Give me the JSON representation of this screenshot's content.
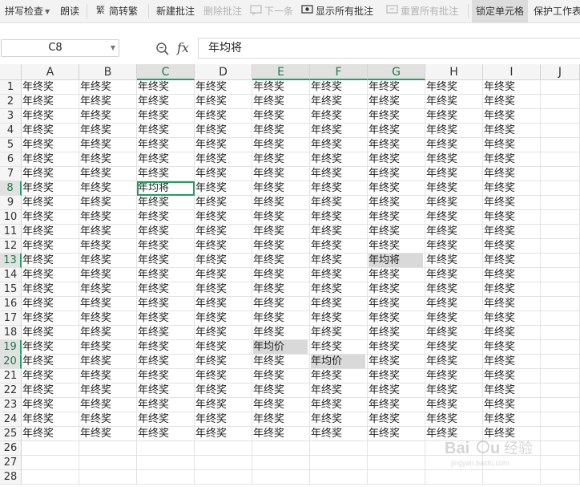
{
  "toolbar": {
    "spell_check": "拼写检查",
    "read_aloud": "朗读",
    "simp_trad": "简转繁",
    "new_comment": "新建批注",
    "delete_comment": "删除批注",
    "next": "下一条",
    "show_all_comments": "显示所有批注",
    "reset_all_comments": "重置所有批注",
    "lock_cell": "锁定单元格",
    "protect_sheet": "保护工作表"
  },
  "formula_bar": {
    "cell_ref": "C8",
    "fx_symbol": "fx",
    "content": "年均将"
  },
  "grid": {
    "columns": [
      "A",
      "B",
      "C",
      "D",
      "E",
      "F",
      "G",
      "H",
      "I",
      "J"
    ],
    "data_columns": [
      "A",
      "B",
      "C",
      "D",
      "E",
      "F",
      "G",
      "H",
      "I"
    ],
    "highlighted_columns": [
      "C",
      "E",
      "F",
      "G"
    ],
    "rows": [
      "1",
      "2",
      "3",
      "4",
      "5",
      "6",
      "7",
      "8",
      "9",
      "10",
      "11",
      "12",
      "13",
      "14",
      "15",
      "16",
      "17",
      "18",
      "19",
      "20",
      "21",
      "22",
      "23",
      "24",
      "25",
      "26",
      "27",
      "28"
    ],
    "data_row_count": 25,
    "highlighted_rows": [
      "8",
      "13",
      "19",
      "20"
    ],
    "default_value": "年终奖",
    "selected_cell": "C8",
    "overrides": [
      {
        "cell": "C8",
        "value": "年均将",
        "fill": "none"
      },
      {
        "cell": "G13",
        "value": "年均将",
        "fill": "#d9d9d9"
      },
      {
        "cell": "E19",
        "value": "年均价",
        "fill": "#d9d9d9"
      },
      {
        "cell": "F20",
        "value": "年均价",
        "fill": "#d9d9d9"
      }
    ]
  },
  "colors": {
    "accent": "#21a366",
    "header_bg": "#f5f5f5",
    "highlight_fill": "#d9d9d9"
  },
  "watermark": "Baidu经验"
}
